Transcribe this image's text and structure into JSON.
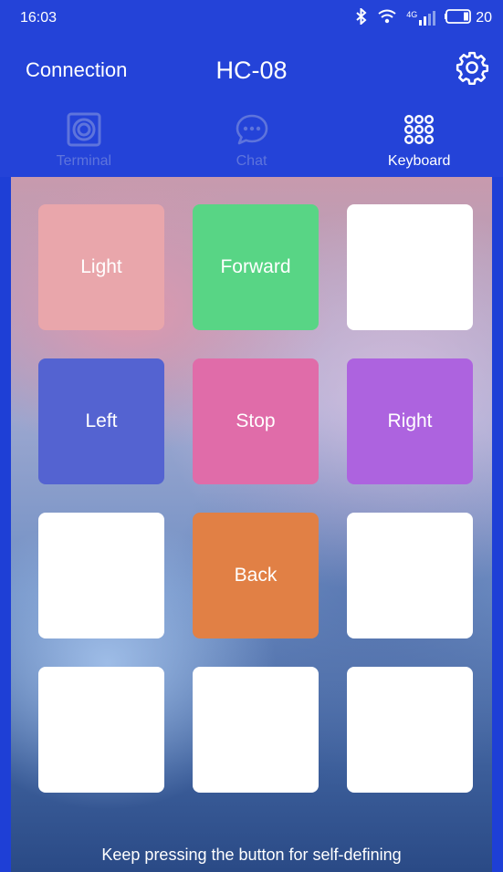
{
  "status": {
    "time": "16:03",
    "network": "4G",
    "battery": "20",
    "icons": [
      "bluetooth-icon",
      "wifi-icon",
      "signal-icon",
      "battery-icon"
    ]
  },
  "appbar": {
    "connection_label": "Connection",
    "device_name": "HC-08",
    "settings_icon": "gear-icon"
  },
  "tabs": [
    {
      "label": "Terminal",
      "icon": "terminal-icon",
      "active": false
    },
    {
      "label": "Chat",
      "icon": "chat-icon",
      "active": false
    },
    {
      "label": "Keyboard",
      "icon": "keypad-icon",
      "active": true
    }
  ],
  "colors": {
    "header": "#2443d8",
    "key_light": "#e9a6ab",
    "key_forward": "#58d585",
    "key_left": "#5463d1",
    "key_stop": "#e06ca9",
    "key_right": "#ad63df",
    "key_back": "#e18045",
    "key_empty": "#ffffff"
  },
  "keys": [
    {
      "label": "Light"
    },
    {
      "label": "Forward"
    },
    {
      "label": ""
    },
    {
      "label": "Left"
    },
    {
      "label": "Stop"
    },
    {
      "label": "Right"
    },
    {
      "label": ""
    },
    {
      "label": "Back"
    },
    {
      "label": ""
    },
    {
      "label": ""
    },
    {
      "label": ""
    },
    {
      "label": ""
    }
  ],
  "hint": "Keep pressing the button for self-defining"
}
